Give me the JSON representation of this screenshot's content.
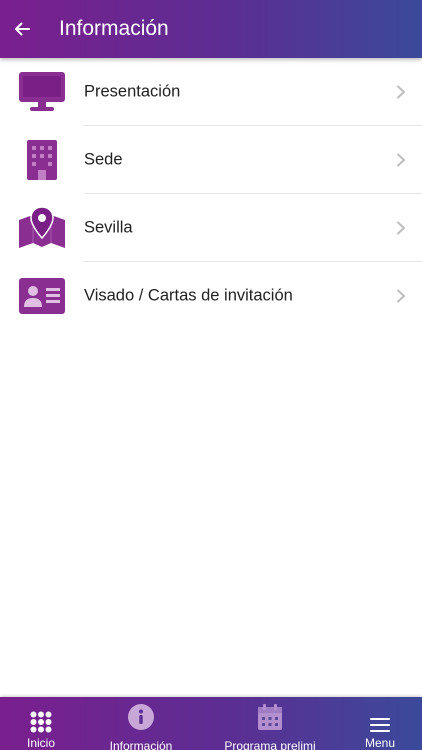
{
  "header": {
    "title": "Información",
    "back_icon": "arrow-left-icon"
  },
  "list": {
    "items": [
      {
        "label": "Presentación",
        "icon": "monitor-icon"
      },
      {
        "label": "Sede",
        "icon": "building-icon"
      },
      {
        "label": "Sevilla",
        "icon": "map-pin-icon"
      },
      {
        "label": "Visado / Cartas de invitación",
        "icon": "id-card-icon"
      }
    ]
  },
  "tabbar": {
    "tabs": [
      {
        "label": "Inicio",
        "icon": "grid-dots-icon"
      },
      {
        "label": "Información",
        "icon": "info-icon",
        "active": true
      },
      {
        "label": "Programa prelimi",
        "icon": "calendar-icon"
      },
      {
        "label": "Menu",
        "icon": "hamburger-icon"
      }
    ]
  },
  "colors": {
    "brand_purple": "#8a2f91",
    "header_gradient_start": "#7a1f8e",
    "header_gradient_end": "#3b4a9b",
    "chevron": "#bdbdbd",
    "text": "#222222",
    "divider": "#e6e6e6"
  }
}
